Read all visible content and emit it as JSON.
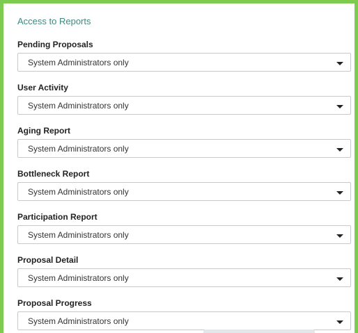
{
  "section": {
    "title": "Access to Reports"
  },
  "reports": [
    {
      "label": "Pending Proposals",
      "value": "System Administrators only"
    },
    {
      "label": "User Activity",
      "value": "System Administrators only"
    },
    {
      "label": "Aging Report",
      "value": "System Administrators only"
    },
    {
      "label": "Bottleneck Report",
      "value": "System Administrators only"
    },
    {
      "label": "Participation Report",
      "value": "System Administrators only"
    },
    {
      "label": "Proposal Detail",
      "value": "System Administrators only"
    },
    {
      "label": "Proposal Progress",
      "value": "System Administrators only"
    }
  ],
  "colors": {
    "frame_border": "#7dcc4f",
    "section_title": "#3c8a80"
  },
  "icons": {
    "dropdown": "caret-down-icon"
  }
}
